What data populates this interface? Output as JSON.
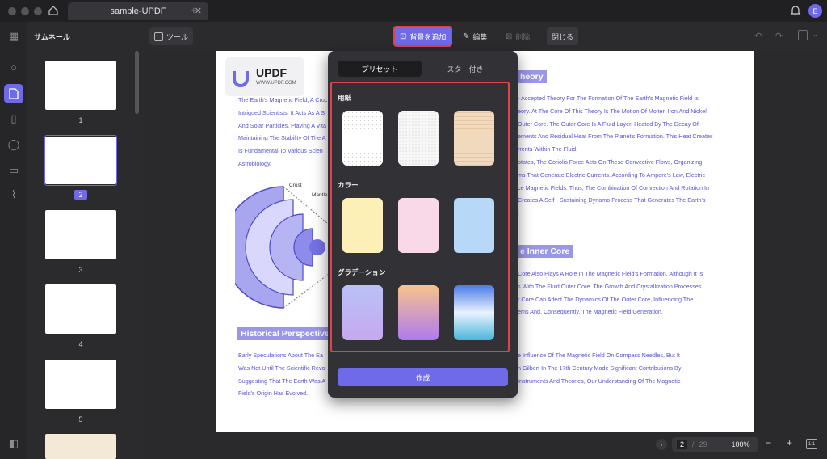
{
  "app": {
    "tab_title": "sample-UPDF",
    "avatar_letter": "E"
  },
  "thumbnails": {
    "title": "サムネール",
    "pages": [
      "1",
      "2",
      "3",
      "4",
      "5"
    ],
    "current": "2"
  },
  "toolbar": {
    "tool_label": "ツール",
    "add_bg_label": "背景を追加",
    "edit_label": "編集",
    "delete_label": "削除",
    "close_label": "閉じる"
  },
  "popup": {
    "tabs": [
      "プリセット",
      "スター付き"
    ],
    "active_tab": "プリセット",
    "sections": [
      {
        "label": "用紙",
        "swatches": [
          "#ffffff",
          "#f2f2f2",
          "#f1d9bd"
        ]
      },
      {
        "label": "カラー",
        "swatches": [
          "#fdefb8",
          "#f9d8e8",
          "#b7d9f7"
        ]
      },
      {
        "label": "グラデーション",
        "swatches": [
          "#b9c1f6/#c6a9ef",
          "#f6c38d/#b07af0",
          "#4a7be6/#eaf3ff/#49b6da"
        ]
      }
    ],
    "create_label": "作成"
  },
  "page": {
    "logo_text": "UPDF",
    "logo_url": "WWW.UPDF.COM",
    "left_para": [
      "The Earth's Magnetic Field, A Crucial",
      "Intrigued Scientists. It Acts As A S",
      "And Solar Particles, Playing A Vita",
      "Maintaining The Stability Of The A",
      "Is Fundamental To Various Scien",
      "Astrobiology."
    ],
    "right_heading1": "heory",
    "right_para1": [
      "- Accepted Theory For The Formation Of The Earth's Magnetic Field Is",
      "eory. At The Core Of This Theory Is The Motion Of Molten Iron And Nickel",
      "Outer Core. The Outer Core Is A Fluid Layer, Heated By The Decay Of",
      "ements And Residual Heat From The Planet's Formation. This Heat Creates",
      "rrents Within The Fluid.",
      "otates, The Coriolis Force Acts On These Convective Flows, Organizing",
      "ms That Generate Electric Currents. According To Ampere's Law, Electric",
      "ce Magnetic Fields. Thus, The Combination Of Convection And Rotation In",
      "Creates A Self - Sustaining Dynamo Process That Generates The Earth's",
      "."
    ],
    "right_heading2": "e Inner Core",
    "right_para2": [
      "Core Also Plays A Role In The Magnetic Field's Formation. Although It Is",
      "s With The Fluid Outer Core. The Growth And Crystallization Processes",
      "r Core Can Affect The Dynamics Of The Outer Core, Influencing The",
      "ems And, Consequently, The Magnetic Field Generation."
    ],
    "diagram_labels": [
      "Crust",
      "Mantle"
    ],
    "hist_heading": "Historical Perspectives",
    "bottom_left": [
      "Early Speculations About The Ea",
      "Was Not Until The Scientific Revo",
      "Suggesting That The Earth Was A",
      "Field's Origin Has Evolved."
    ],
    "bottom_right": [
      "e Influence Of The Magnetic Field On Compass Needles, But It",
      "n Gilbert In The 17th Century Made Significant Contributions By",
      "Instruments And Theories, Our Understanding Of The Magnetic",
      ""
    ]
  },
  "status": {
    "current_page": "2",
    "separator": "/",
    "total_pages": "29",
    "zoom": "100%",
    "fit_label": "1:1"
  },
  "colors": {
    "accent": "#6f6ae8",
    "highlight_border": "#e0434d"
  }
}
